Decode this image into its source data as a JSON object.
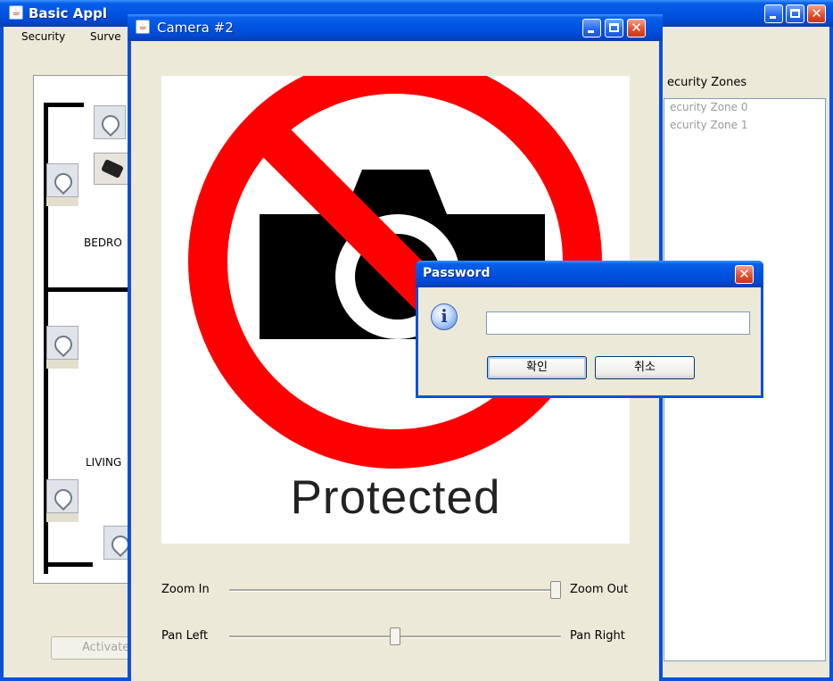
{
  "main_window": {
    "title": "Basic Appl",
    "icon": "java-cup-icon",
    "menu": [
      "Security",
      "Surve"
    ],
    "floorplan": {
      "rooms": [
        "BEDRO",
        "LIVING"
      ]
    },
    "activate_button": "Activate",
    "zones": {
      "label": "ecurity Zones",
      "items": [
        "ecurity Zone 0",
        "ecurity Zone 1"
      ]
    }
  },
  "camera_window": {
    "title": "Camera #2",
    "icon": "java-cup-icon",
    "image": {
      "caption": "Protected",
      "icon": "no-camera-icon"
    },
    "zoom": {
      "left_label": "Zoom In",
      "right_label": "Zoom Out",
      "value": 1.0
    },
    "pan": {
      "left_label": "Pan Left",
      "right_label": "Pan Right",
      "value": 0.5
    }
  },
  "password_dialog": {
    "title": "Password",
    "icon": "info-icon",
    "input_value": "",
    "ok_label": "확인",
    "cancel_label": "취소"
  },
  "colors": {
    "titlebar": "#0054e3",
    "prohibition_red": "#ff0000",
    "window_bg": "#ece9d8"
  }
}
